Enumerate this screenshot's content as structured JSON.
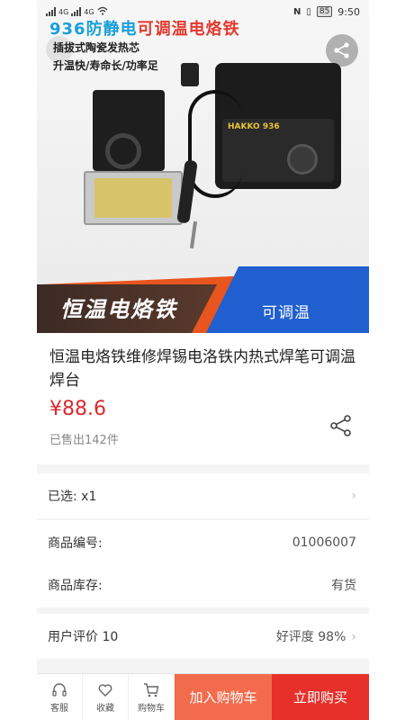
{
  "status_bar": {
    "network": "4G",
    "network2": "4G",
    "battery": "85",
    "time": "9:50"
  },
  "hero": {
    "title_blue": "936防静电",
    "title_red": "可调温电烙铁",
    "line1": "插拔式陶瓷发热芯",
    "line2": "升温快/寿命长/功率足",
    "brand": "HAKKO 936",
    "banner_main": "恒温电烙铁",
    "banner_side": "可调温"
  },
  "product": {
    "title": "恒温电烙铁维修焊锡电洛铁内热式焊笔可调温焊台",
    "price": "¥88.6",
    "sold": "已售出142件"
  },
  "rows": {
    "selected_label": "已选:",
    "selected_value": "x1",
    "code_label": "商品编号:",
    "code_value": "01006007",
    "stock_label": "商品库存:",
    "stock_value": "有货",
    "review_label": "用户评价 10",
    "review_value": "好评度 98%"
  },
  "bottom_bar": {
    "service": "客服",
    "favorite": "收藏",
    "cart": "购物车",
    "add_cart": "加入购物车",
    "buy_now": "立即购买"
  },
  "colors": {
    "price_red": "#d9292f",
    "cart_orange": "#f26b4d",
    "buy_red": "#e7302a",
    "banner_blue": "#1f5fcf",
    "banner_orange": "#e8551e"
  }
}
